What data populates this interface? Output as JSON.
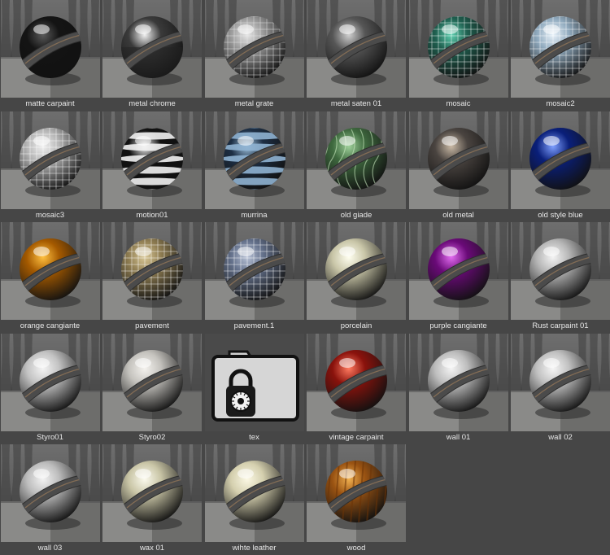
{
  "window": {
    "background": "#464646"
  },
  "materials": [
    {
      "label": "matte carpaint",
      "icon": "material-sphere",
      "base": "#141414",
      "highlight": "#5a5a5a",
      "pattern": "none"
    },
    {
      "label": "metal chrome",
      "icon": "material-sphere",
      "base": "#3a3a3a",
      "highlight": "#f2f2f2",
      "pattern": "chrome"
    },
    {
      "label": "metal grate",
      "icon": "material-sphere",
      "base": "#9a9a9a",
      "highlight": "#e6e6e6",
      "pattern": "grid"
    },
    {
      "label": "metal saten 01",
      "icon": "material-sphere",
      "base": "#565656",
      "highlight": "#cfcfcf",
      "pattern": "none"
    },
    {
      "label": "mosaic",
      "icon": "material-sphere",
      "base": "#1f5f4f",
      "highlight": "#5fd0b0",
      "pattern": "tiles"
    },
    {
      "label": "mosaic2",
      "icon": "material-sphere",
      "base": "#8fa9bd",
      "highlight": "#e8f2fa",
      "pattern": "tiles"
    },
    {
      "label": "mosaic3",
      "icon": "material-sphere",
      "base": "#b5b5b5",
      "highlight": "#f0f0f0",
      "pattern": "tiles"
    },
    {
      "label": "motion01",
      "icon": "material-sphere",
      "base": "#111111",
      "highlight": "#f4f4f4",
      "pattern": "stripes"
    },
    {
      "label": "murrina",
      "icon": "material-sphere",
      "base": "#1d2f45",
      "highlight": "#9ec2de",
      "pattern": "stripes-blue"
    },
    {
      "label": "old giade",
      "icon": "material-sphere",
      "base": "#3f6a3f",
      "highlight": "#9ed09a",
      "pattern": "marble"
    },
    {
      "label": "old metal",
      "icon": "material-sphere",
      "base": "#4a4440",
      "highlight": "#c9b9a5",
      "pattern": "none"
    },
    {
      "label": "old style blue",
      "icon": "material-sphere",
      "base": "#0a1f7a",
      "highlight": "#7fa0ff",
      "pattern": "none"
    },
    {
      "label": "orange cangiante",
      "icon": "material-sphere",
      "base": "#a55a00",
      "highlight": "#ffc040",
      "pattern": "none"
    },
    {
      "label": "pavement",
      "icon": "material-sphere",
      "base": "#8f7d52",
      "highlight": "#d9c897",
      "pattern": "tiles"
    },
    {
      "label": "pavement.1",
      "icon": "material-sphere",
      "base": "#63708a",
      "highlight": "#b8c2d6",
      "pattern": "tiles"
    },
    {
      "label": "porcelain",
      "icon": "material-sphere",
      "base": "#c9c6a8",
      "highlight": "#fffff0",
      "pattern": "none"
    },
    {
      "label": "purple cangiante",
      "icon": "material-sphere",
      "base": "#6a0a78",
      "highlight": "#e26cf0",
      "pattern": "none"
    },
    {
      "label": "Rust carpaint 01",
      "icon": "material-sphere",
      "base": "#b6b6b6",
      "highlight": "#f4f4f4",
      "pattern": "none"
    },
    {
      "label": "Styro01",
      "icon": "material-sphere",
      "base": "#c2c2c2",
      "highlight": "#f4f4f4",
      "pattern": "none"
    },
    {
      "label": "Styro02",
      "icon": "material-sphere",
      "base": "#c4c2bd",
      "highlight": "#f4f2ee",
      "pattern": "none"
    },
    {
      "label": "tex",
      "icon": "locked-folder-icon",
      "base": "#d9d9d9",
      "highlight": "#ffffff",
      "pattern": "folder"
    },
    {
      "label": "vintage carpaint",
      "icon": "material-sphere",
      "base": "#8a120c",
      "highlight": "#ff7a60",
      "pattern": "none"
    },
    {
      "label": "wall 01",
      "icon": "material-sphere",
      "base": "#bdbdbd",
      "highlight": "#f4f4f4",
      "pattern": "none"
    },
    {
      "label": "wall 02",
      "icon": "material-sphere",
      "base": "#c0c0c0",
      "highlight": "#f6f6f6",
      "pattern": "none"
    },
    {
      "label": "wall 03",
      "icon": "material-sphere",
      "base": "#bcbcbc",
      "highlight": "#f2f2f2",
      "pattern": "none"
    },
    {
      "label": "wax 01",
      "icon": "material-sphere",
      "base": "#c9c5a6",
      "highlight": "#fbfaee",
      "pattern": "none"
    },
    {
      "label": "wihte leather",
      "icon": "material-sphere",
      "base": "#d4cfae",
      "highlight": "#fbf8e4",
      "pattern": "none"
    },
    {
      "label": "wood",
      "icon": "material-sphere",
      "base": "#9a5312",
      "highlight": "#f0b050",
      "pattern": "wood"
    }
  ]
}
